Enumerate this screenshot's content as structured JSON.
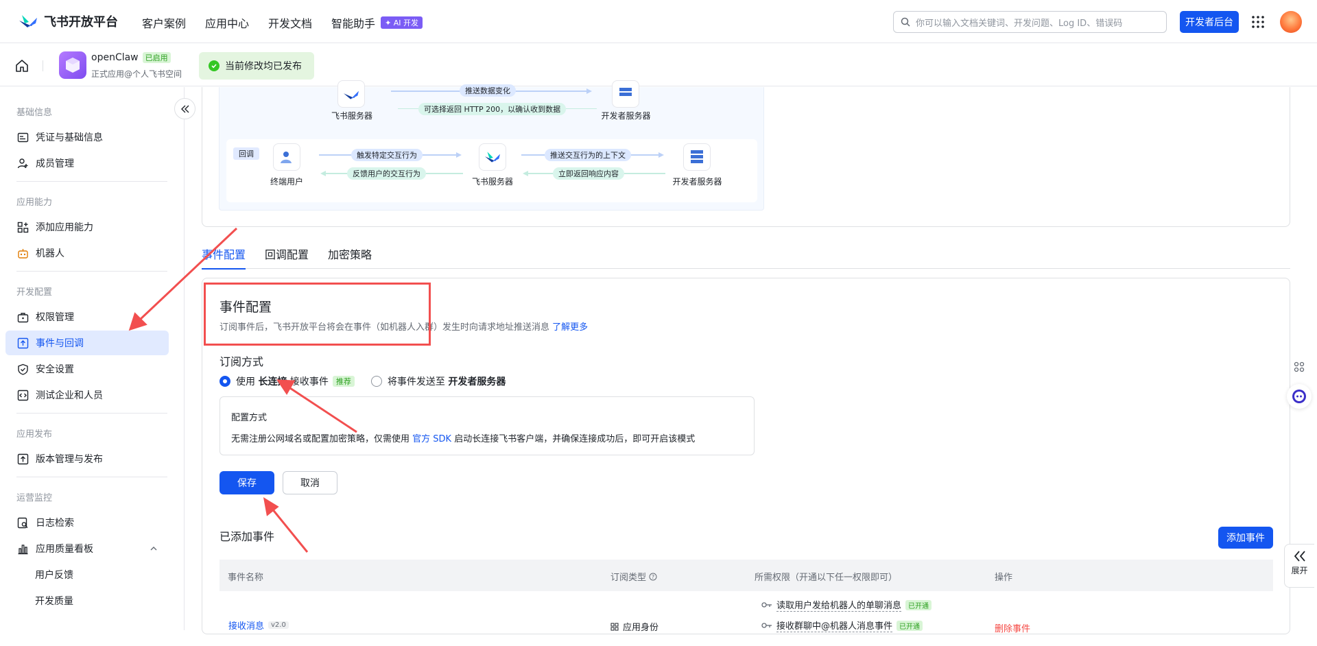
{
  "topbar": {
    "brand": "飞书开放平台",
    "nav": [
      "客户案例",
      "应用中心",
      "开发文档",
      "智能助手"
    ],
    "ai_badge": "✦ AI 开发",
    "search_placeholder": "你可以输入文档关键词、开发问题、Log ID、错误码",
    "dev_console": "开发者后台"
  },
  "app": {
    "name": "openClaw",
    "status": "已启用",
    "subtitle": "正式应用@个人飞书空间",
    "publish_status": "当前修改均已发布"
  },
  "sidebar": {
    "sections": [
      {
        "title": "基础信息",
        "items": [
          "凭证与基础信息",
          "成员管理"
        ]
      },
      {
        "title": "应用能力",
        "items": [
          "添加应用能力",
          "机器人"
        ]
      },
      {
        "title": "开发配置",
        "items": [
          "权限管理",
          "事件与回调",
          "安全设置",
          "测试企业和人员"
        ]
      },
      {
        "title": "应用发布",
        "items": [
          "版本管理与发布"
        ]
      },
      {
        "title": "运营监控",
        "items": [
          "日志检索",
          "应用质量看板",
          "用户反馈",
          "开发质量"
        ]
      }
    ],
    "active_item": "事件与回调"
  },
  "diagram": {
    "top_row": {
      "left_label": "飞书服务器",
      "right_label": "开发者服务器",
      "arrow_top": "推送数据变化",
      "arrow_bottom": "可选择返回 HTTP 200，以确认收到数据"
    },
    "callback_row": {
      "tag": "回调",
      "user_label": "终端用户",
      "feishu_label": "飞书服务器",
      "dev_label": "开发者服务器",
      "a1": "触发特定交互行为",
      "a2": "反馈用户的交互行为",
      "a3": "推送交互行为的上下文",
      "a4": "立即返回响应内容"
    }
  },
  "tabs": [
    "事件配置",
    "回调配置",
    "加密策略"
  ],
  "event_config": {
    "title": "事件配置",
    "desc": "订阅事件后，飞书开放平台将会在事件（如机器人入群）发生时向请求地址推送消息",
    "learn_more": "了解更多",
    "subscribe_title": "订阅方式",
    "option1_prefix": "使用",
    "option1_bold": "长连接",
    "option1_suffix": "接收事件",
    "recommend": "推荐",
    "option2_prefix": "将事件发送至",
    "option2_bold": "开发者服务器",
    "method_title": "配置方式",
    "method_desc_1": "无需注册公网域名或配置加密策略，仅需使用",
    "method_link": "官方 SDK",
    "method_desc_2": "启动长连接飞书客户端，并确保连接成功后，即可开启该模式",
    "save": "保存",
    "cancel": "取消"
  },
  "added_events": {
    "title": "已添加事件",
    "add_button": "添加事件",
    "columns": [
      "事件名称",
      "订阅类型",
      "所需权限（开通以下任一权限即可）",
      "操作"
    ],
    "rows": [
      {
        "name": "接收消息",
        "version": "v2.0",
        "type": "应用身份",
        "permissions": [
          "读取用户发给机器人的单聊消息",
          "接收群聊中@机器人消息事件"
        ],
        "perm_status": "已开通",
        "action": "删除事件"
      }
    ]
  },
  "right_rail": {
    "expand_label": "展开"
  }
}
